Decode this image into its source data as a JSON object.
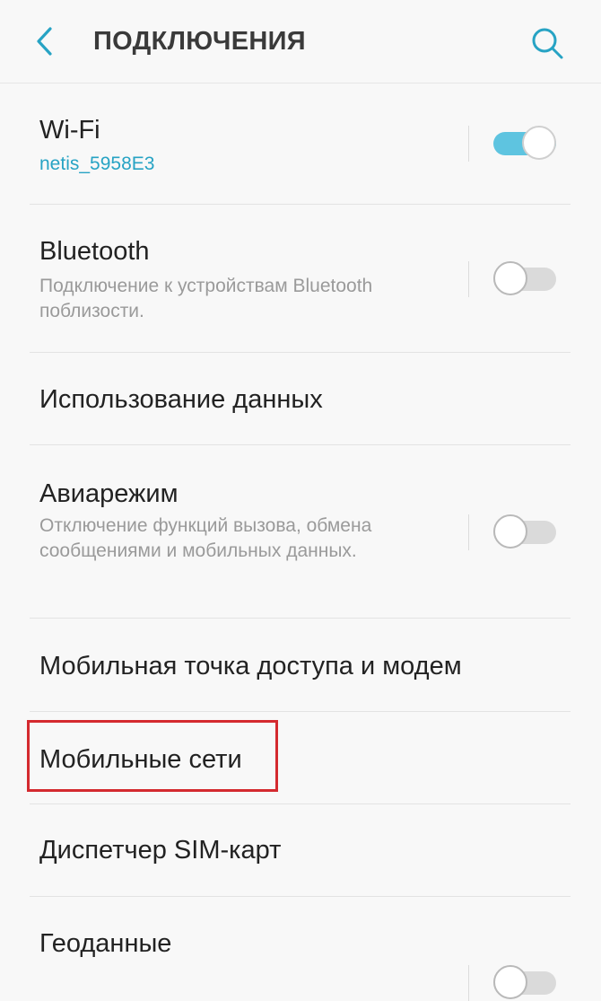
{
  "header": {
    "title": "ПОДКЛЮЧЕНИЯ",
    "back_icon": "chevron-left-icon",
    "search_icon": "search-icon"
  },
  "colors": {
    "accent": "#27a3c4",
    "toggle_on": "#5ec4e0",
    "highlight": "#d42a2f"
  },
  "items": [
    {
      "id": "wifi",
      "title": "Wi-Fi",
      "subtitle": "netis_5958E3",
      "toggle": true
    },
    {
      "id": "bluetooth",
      "title": "Bluetooth",
      "subtitle": "Подключение к устройствам Bluetooth поблизости.",
      "toggle": false
    },
    {
      "id": "data-usage",
      "title": "Использование данных"
    },
    {
      "id": "airplane",
      "title": "Авиарежим",
      "subtitle": "Отключение функций вызова, обмена сообщениями и мобильных данных.",
      "toggle": false
    },
    {
      "id": "hotspot",
      "title": "Мобильная точка доступа и модем"
    },
    {
      "id": "mobile-networks",
      "title": "Мобильные сети",
      "highlighted": true
    },
    {
      "id": "sim-manager",
      "title": "Диспетчер SIM-карт"
    },
    {
      "id": "location",
      "title": "Геоданные",
      "toggle": false
    }
  ]
}
